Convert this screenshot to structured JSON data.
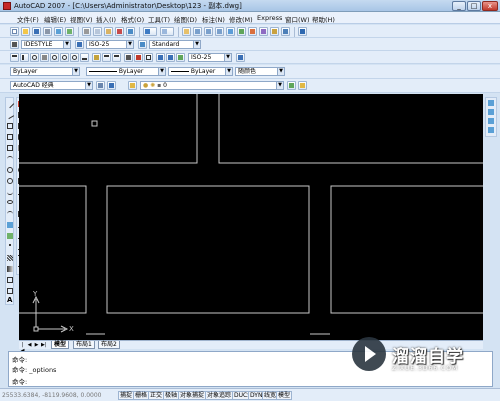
{
  "window": {
    "title": "AutoCAD 2007 - [C:\\Users\\Administrator\\Desktop\\123 - 副本.dwg]",
    "min_glyph": "_",
    "max_glyph": "□",
    "close_glyph": "x"
  },
  "menu": {
    "items": [
      "文件(F)",
      "编辑(E)",
      "视图(V)",
      "插入(I)",
      "格式(O)",
      "工具(T)",
      "绘图(D)",
      "标注(N)",
      "修改(M)",
      "Express",
      "窗口(W)",
      "帮助(H)"
    ]
  },
  "styles_toolbar": {
    "text_style": "IDESTYLE",
    "dim_style": "ISO-25",
    "table_style": "Standard"
  },
  "dim_toolbar": {
    "dim_style": "ISO-25"
  },
  "properties_toolbar": {
    "color": "ByLayer",
    "linetype": "ByLayer",
    "lineweight": "ByLayer",
    "plotstyle": "随颜色"
  },
  "layers_toolbar": {
    "workspace": "AutoCAD 经典",
    "layer": "0"
  },
  "tabs": {
    "items": [
      "模型",
      "布局1",
      "布局2"
    ],
    "nav": [
      "|◀",
      "◀",
      "▶",
      "▶|"
    ]
  },
  "command": {
    "lines": [
      "命令:",
      "命令: _options",
      "命令:"
    ]
  },
  "status": {
    "coordinates": "25533.6384, -8119.9608, 0.0000",
    "buttons": [
      "捕捉",
      "栅格",
      "正交",
      "极轴",
      "对象捕捉",
      "对象追踪",
      "DUCS",
      "DYN",
      "线宽",
      "模型"
    ]
  },
  "watermark": {
    "title": "溜溜自学",
    "subtitle": "ZIXUE.3D66.COM"
  },
  "ucs": {
    "x_label": "X",
    "y_label": "Y"
  },
  "colors": {
    "canvas": "#000000",
    "lines": "#c8c8c8"
  }
}
